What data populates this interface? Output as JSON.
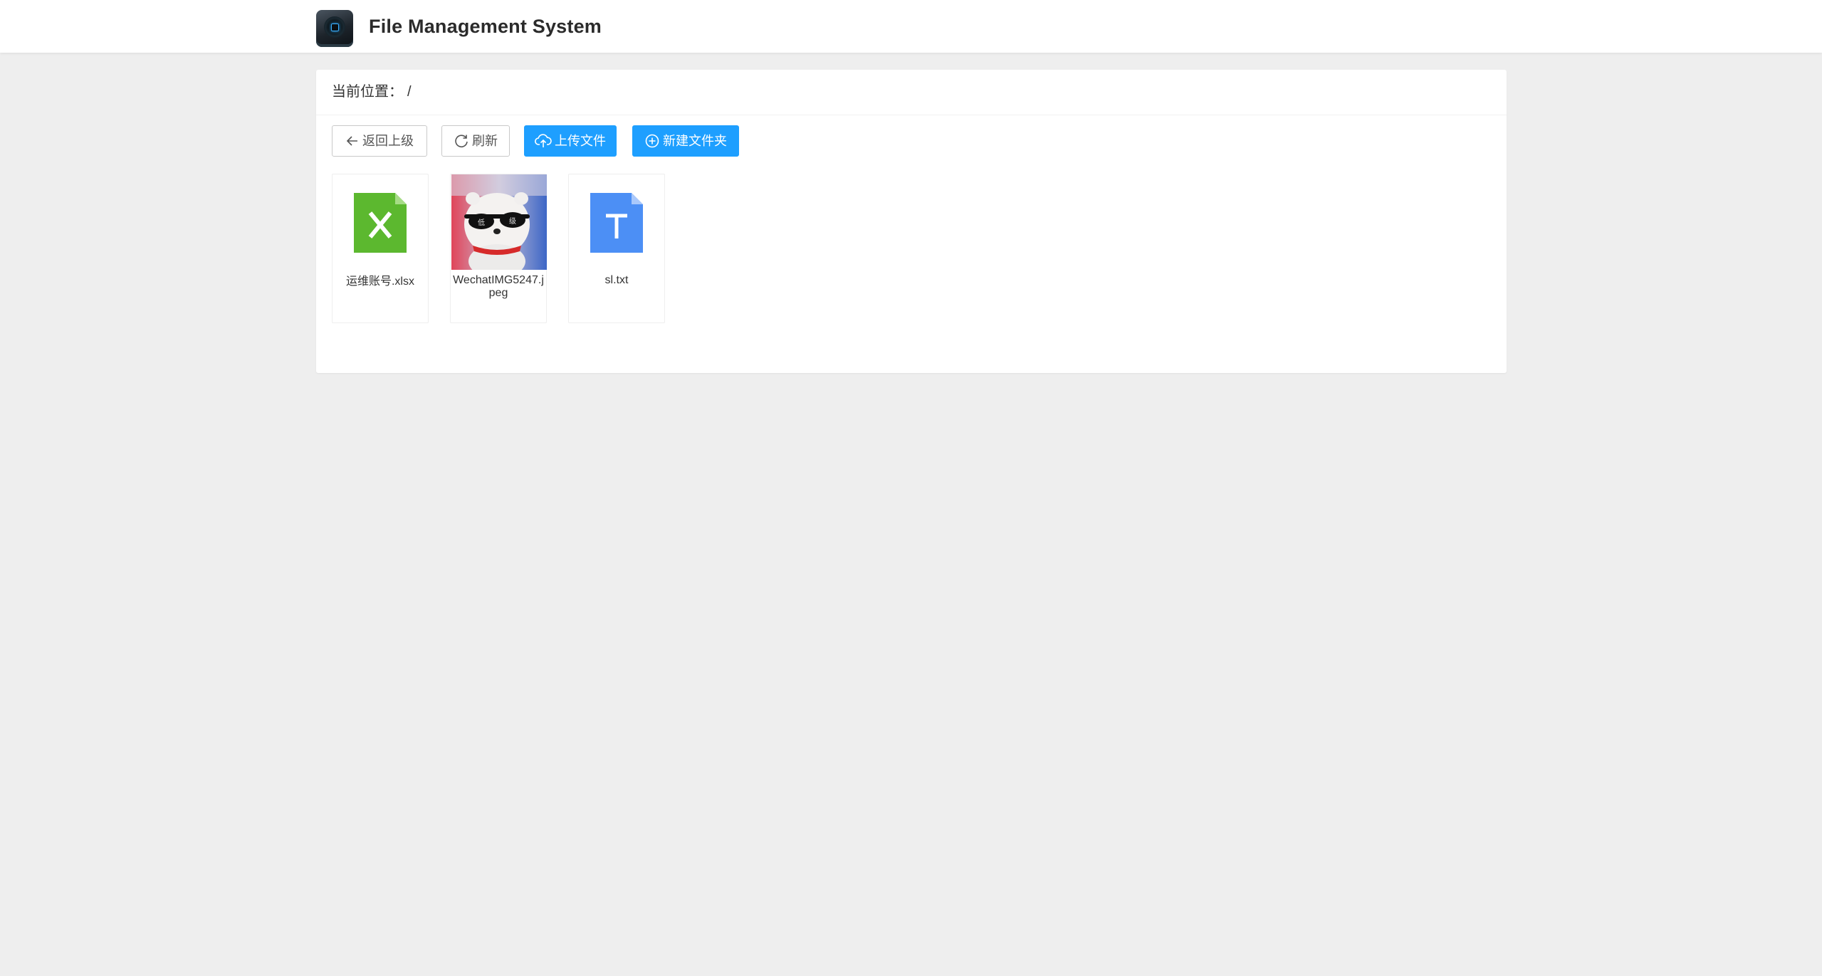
{
  "header": {
    "app_title": "File Management System",
    "logo_icon": "camera-logo-icon"
  },
  "breadcrumb": {
    "label": "当前位置：",
    "path": "/"
  },
  "toolbar": {
    "back_label": "返回上级",
    "refresh_label": "刷新",
    "upload_label": "上传文件",
    "new_folder_label": "新建文件夹",
    "accent_color": "#1e9fff"
  },
  "files": [
    {
      "name": "运维账号.xlsx",
      "type": "xlsx",
      "icon": "excel-file-icon",
      "color": "#5cb82f"
    },
    {
      "name": "WechatIMG5247.jpeg",
      "type": "jpeg",
      "icon": "image-thumbnail",
      "thumbnail_text": [
        "低",
        "级"
      ]
    },
    {
      "name": "sl.txt",
      "type": "txt",
      "icon": "text-file-icon",
      "color": "#4c8ff5"
    }
  ]
}
